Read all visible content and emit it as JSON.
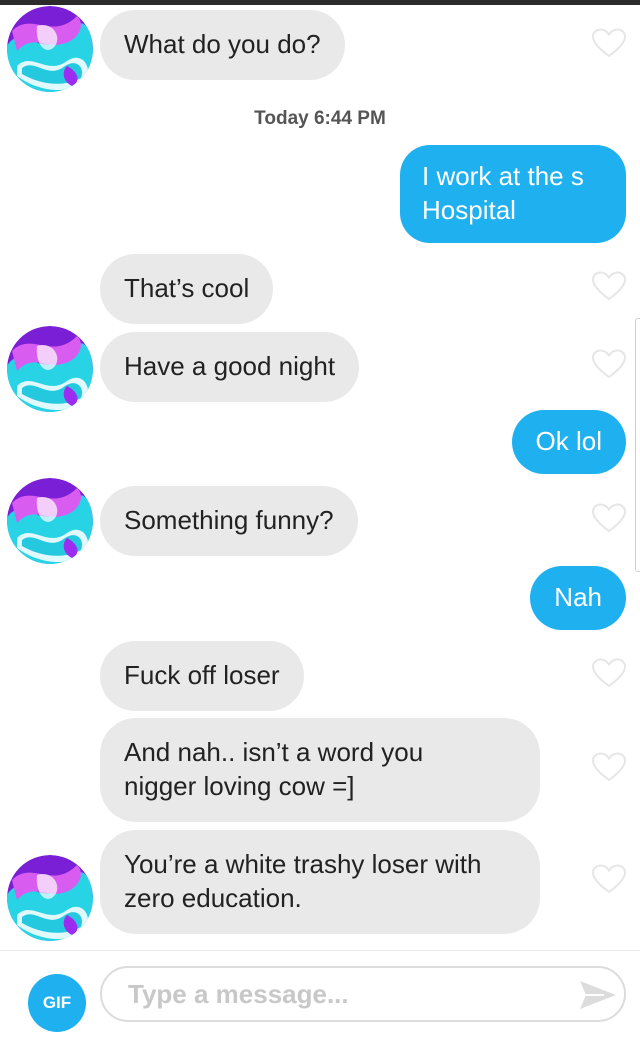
{
  "messages": [
    {
      "side": "in",
      "text": "What do you do?"
    },
    {
      "side": "out",
      "text": "I work at the s\nHospital"
    },
    {
      "side": "in",
      "text": "That’s cool"
    },
    {
      "side": "in",
      "text": "Have a good night"
    },
    {
      "side": "out",
      "text": "Ok lol"
    },
    {
      "side": "in",
      "text": "Something funny?"
    },
    {
      "side": "out",
      "text": "Nah"
    },
    {
      "side": "in",
      "text": "Fuck off loser"
    },
    {
      "side": "in",
      "text": "And nah.. isn’t a word you\nnigger loving cow =]"
    },
    {
      "side": "in",
      "text": "You’re a white trashy loser with\nzero education."
    }
  ],
  "timestamp": {
    "day": "Today",
    "time": "6:44 PM",
    "label": "Today 6:44 PM"
  },
  "composer": {
    "gif_label": "GIF",
    "placeholder": "Type a message...",
    "value": "",
    "send_icon": "send-arrow-icon"
  },
  "icons": {
    "like": "heart-outline-icon",
    "avatar": "avatar-swirl-image"
  },
  "colors": {
    "incoming_bubble": "#e9e9e9",
    "outgoing_bubble": "#1fb0f0",
    "accent": "#1fb0f0",
    "heart_outline": "#e6e6e6"
  }
}
